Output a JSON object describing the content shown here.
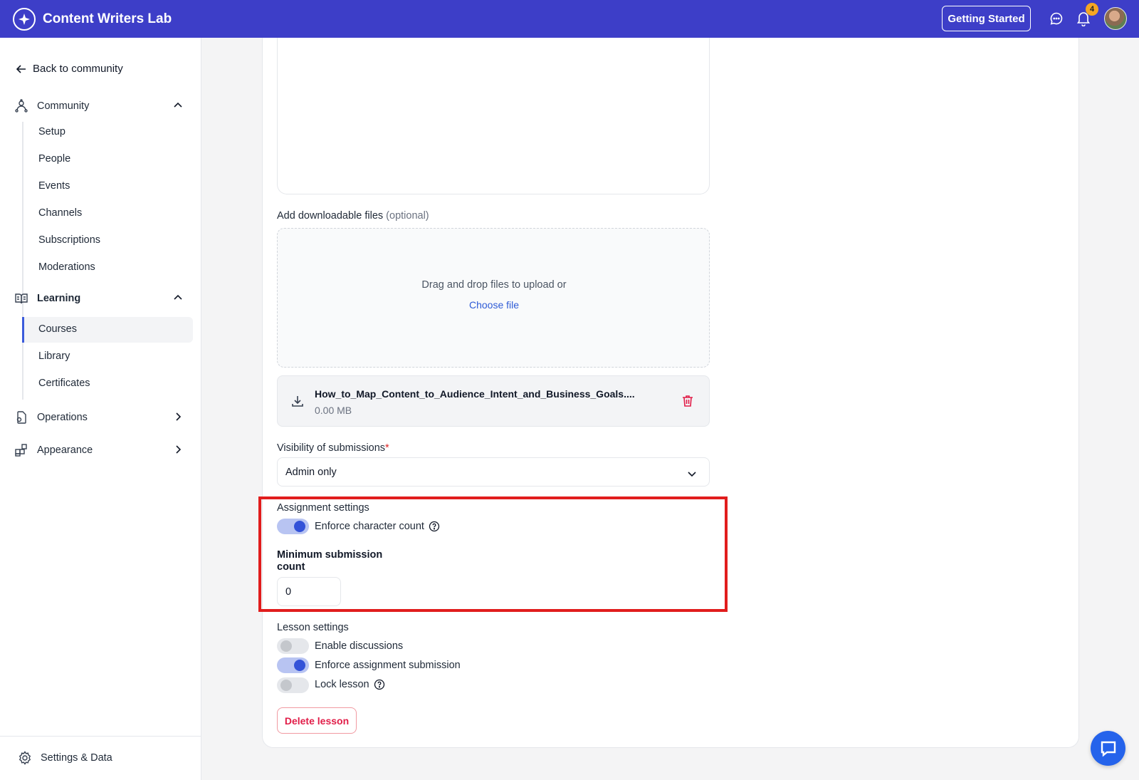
{
  "app": {
    "name": "Content Writers Lab",
    "getting_started": "Getting Started",
    "notification_count": "4"
  },
  "sidebar": {
    "back": "Back to community",
    "community": {
      "label": "Community",
      "items": [
        "Setup",
        "People",
        "Events",
        "Channels",
        "Subscriptions",
        "Moderations"
      ]
    },
    "learning": {
      "label": "Learning",
      "items": [
        "Courses",
        "Library",
        "Certificates"
      ],
      "active": "Courses"
    },
    "operations": "Operations",
    "appearance": "Appearance",
    "settings": "Settings & Data"
  },
  "form": {
    "files_label": "Add downloadable files",
    "files_optional": "(optional)",
    "dropzone_text": "Drag and drop files to upload or",
    "choose_file": "Choose file",
    "file": {
      "name": "How_to_Map_Content_to_Audience_Intent_and_Business_Goals....",
      "size": "0.00 MB"
    },
    "visibility_label": "Visibility of submissions",
    "required_mark": "*",
    "visibility_value": "Admin only",
    "assignment_settings": "Assignment settings",
    "enforce_char_count": "Enforce character count",
    "enforce_char_count_on": true,
    "min_submission_label": "Minimum submission count",
    "min_submission_value": "0",
    "lesson_settings": "Lesson settings",
    "toggles": [
      {
        "label": "Enable discussions",
        "on": false
      },
      {
        "label": "Enforce assignment submission",
        "on": true
      },
      {
        "label": "Lock lesson",
        "on": false
      }
    ],
    "delete_lesson": "Delete lesson"
  },
  "colors": {
    "topbar": "#3d3ec8",
    "accent": "#3352d8",
    "danger": "#e11d48",
    "highlight": "#e11d1d"
  }
}
